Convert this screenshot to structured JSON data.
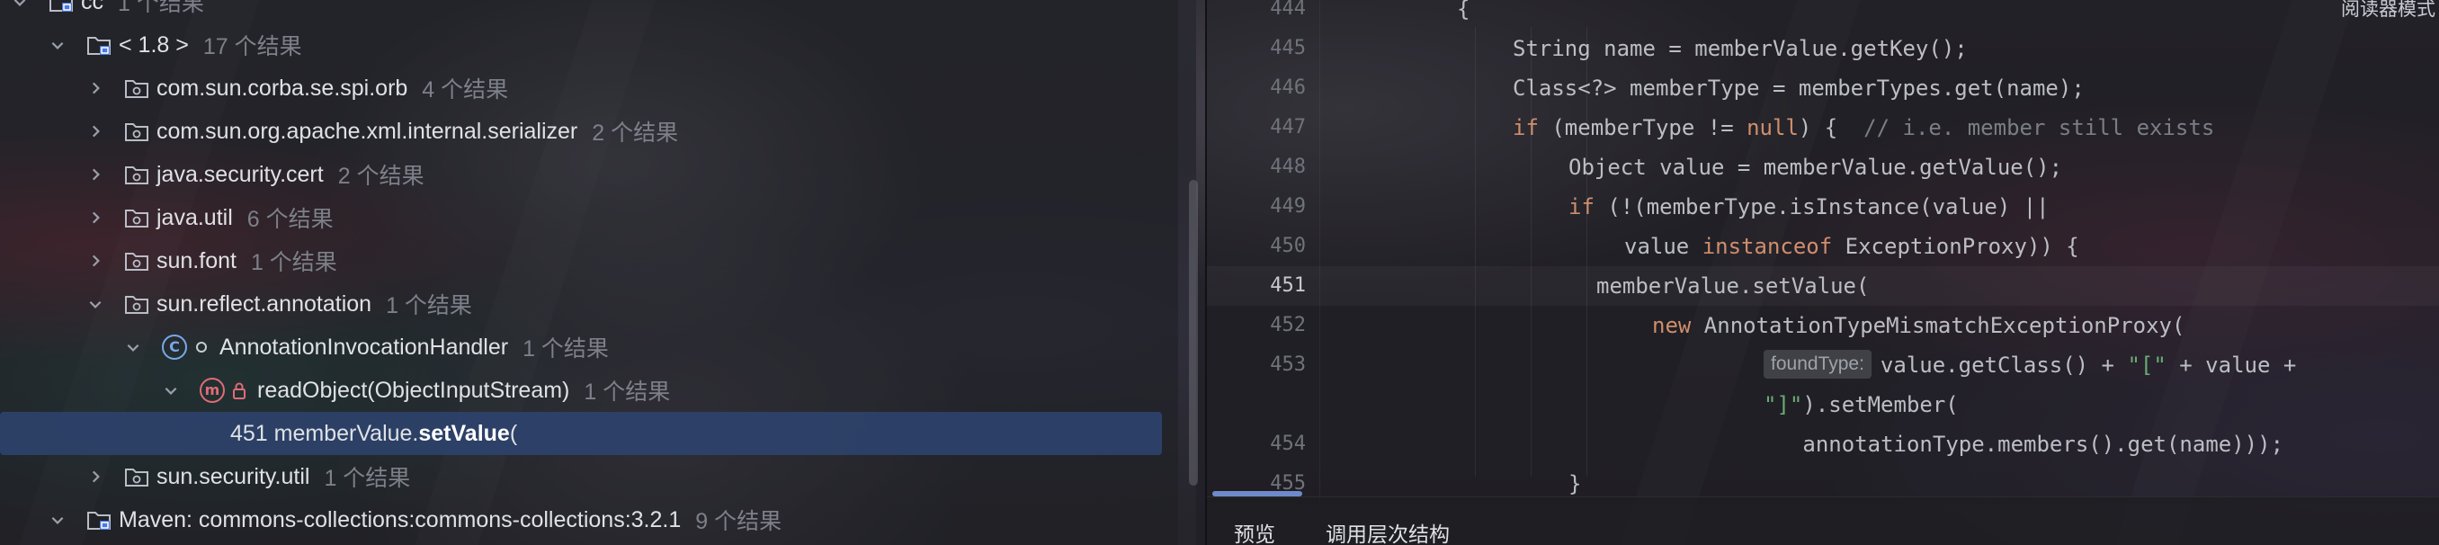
{
  "tree": {
    "rows": [
      {
        "indent": 0,
        "expanded": true,
        "icon": "library-folder-icon",
        "name": "cc",
        "count": "1 个结果",
        "partial": true
      },
      {
        "indent": 1,
        "expanded": true,
        "icon": "library-folder-icon",
        "name": "< 1.8 >",
        "count": "17 个结果"
      },
      {
        "indent": 2,
        "expanded": false,
        "icon": "package-folder-icon",
        "name": "com.sun.corba.se.spi.orb",
        "count": "4 个结果"
      },
      {
        "indent": 2,
        "expanded": false,
        "icon": "package-folder-icon",
        "name": "com.sun.org.apache.xml.internal.serializer",
        "count": "2 个结果"
      },
      {
        "indent": 2,
        "expanded": false,
        "icon": "package-folder-icon",
        "name": "java.security.cert",
        "count": "2 个结果"
      },
      {
        "indent": 2,
        "expanded": false,
        "icon": "package-folder-icon",
        "name": "java.util",
        "count": "6 个结果"
      },
      {
        "indent": 2,
        "expanded": false,
        "icon": "package-folder-icon",
        "name": "sun.font",
        "count": "1 个结果"
      },
      {
        "indent": 2,
        "expanded": true,
        "icon": "package-folder-icon",
        "name": "sun.reflect.annotation",
        "count": "1 个结果"
      },
      {
        "indent": 3,
        "expanded": true,
        "icon": "class-icon",
        "name": "AnnotationInvocationHandler",
        "count": "1 个结果"
      },
      {
        "indent": 4,
        "expanded": true,
        "icon": "method-icon",
        "name": "readObject(ObjectInputStream)",
        "count": "1 个结果"
      },
      {
        "indent": 5,
        "expanded": null,
        "icon": "none",
        "name": "451 memberValue.",
        "bold": "setValue",
        "tail": "(",
        "count": "",
        "selected": true
      },
      {
        "indent": 2,
        "expanded": false,
        "icon": "package-folder-icon",
        "name": "sun.security.util",
        "count": "1 个结果"
      },
      {
        "indent": 1,
        "expanded": true,
        "icon": "library-folder-icon",
        "name": "Maven: commons-collections:commons-collections:3.2.1",
        "count": "9 个结果"
      }
    ]
  },
  "editor": {
    "reader_mode_label": "阅读器模式",
    "lines": [
      {
        "num": "444",
        "indent": 0,
        "tokens": [
          [
            "plain",
            "{"
          ]
        ]
      },
      {
        "num": "445",
        "indent": 1,
        "tokens": [
          [
            "plain",
            "String name = memberValue.getKey();"
          ]
        ]
      },
      {
        "num": "446",
        "indent": 1,
        "tokens": [
          [
            "plain",
            "Class<?> memberType = memberTypes.get(name);"
          ]
        ]
      },
      {
        "num": "447",
        "indent": 1,
        "tokens": [
          [
            "kw",
            "if"
          ],
          [
            "plain",
            " (memberType != "
          ],
          [
            "kw",
            "null"
          ],
          [
            "plain",
            ") {  "
          ],
          [
            "cm",
            "// i.e. member still exists"
          ]
        ]
      },
      {
        "num": "448",
        "indent": 2,
        "tokens": [
          [
            "plain",
            "Object value = memberValue.getValue();"
          ]
        ]
      },
      {
        "num": "449",
        "indent": 2,
        "tokens": [
          [
            "kw",
            "if"
          ],
          [
            "plain",
            " (!(memberType.isInstance(value) ||"
          ]
        ]
      },
      {
        "num": "450",
        "indent": 3,
        "tokens": [
          [
            "plain",
            "value "
          ],
          [
            "kw",
            "instanceof"
          ],
          [
            "plain",
            " ExceptionProxy)) {"
          ]
        ]
      },
      {
        "num": "451",
        "indent": 2.5,
        "current": true,
        "tokens": [
          [
            "plain",
            "memberValue.setValue("
          ]
        ]
      },
      {
        "num": "452",
        "indent": 3.5,
        "tokens": [
          [
            "kw",
            "new"
          ],
          [
            "plain",
            " AnnotationTypeMismatchExceptionProxy("
          ]
        ]
      },
      {
        "num": "453",
        "indent": 5.5,
        "inlay": "foundType:",
        "tokens": [
          [
            "plain",
            "value.getClass() + "
          ],
          [
            "str",
            "\"[\""
          ],
          [
            "plain",
            " + value +"
          ]
        ]
      },
      {
        "num": "",
        "indent": 5.5,
        "tokens": [
          [
            "str",
            "\"]\""
          ],
          [
            "plain",
            ").setMember("
          ]
        ]
      },
      {
        "num": "454",
        "indent": 6.2,
        "tokens": [
          [
            "plain",
            "annotationType.members().get(name)));"
          ]
        ]
      },
      {
        "num": "455",
        "indent": 2,
        "tokens": [
          [
            "plain",
            "}"
          ]
        ]
      }
    ]
  },
  "bottom_tabs": [
    "预览",
    "调用层次结构"
  ]
}
